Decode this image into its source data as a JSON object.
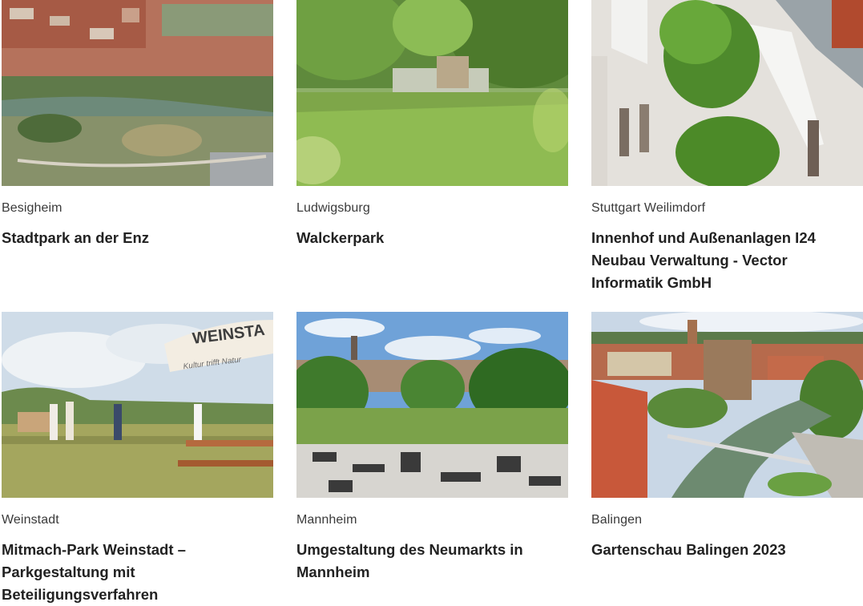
{
  "projects": [
    {
      "location": "Besigheim",
      "title": "Stadtpark an der Enz",
      "image": "aerial-town-park-photo"
    },
    {
      "location": "Ludwigsburg",
      "title": "Walckerpark",
      "image": "green-meadow-park-photo"
    },
    {
      "location": "Stuttgart Weilimdorf",
      "title": "Innenhof und Außenanlagen I24 Neubau Verwaltung - Vector Informatik GmbH",
      "image": "courtyard-trees-photo"
    },
    {
      "location": "Weinstadt",
      "title": "Mitmach-Park Weinstadt – Parkgestaltung mit Beteiligungsverfahren",
      "image": "participation-event-photo"
    },
    {
      "location": "Mannheim",
      "title": "Umgestaltung des Neumarkts in Mannheim",
      "image": "market-square-photo"
    },
    {
      "location": "Balingen",
      "title": "Gartenschau Balingen 2023",
      "image": "river-old-town-photo"
    }
  ],
  "umbrella_text": "WEINSTA",
  "umbrella_subtext": "Kultur trifft Natur"
}
